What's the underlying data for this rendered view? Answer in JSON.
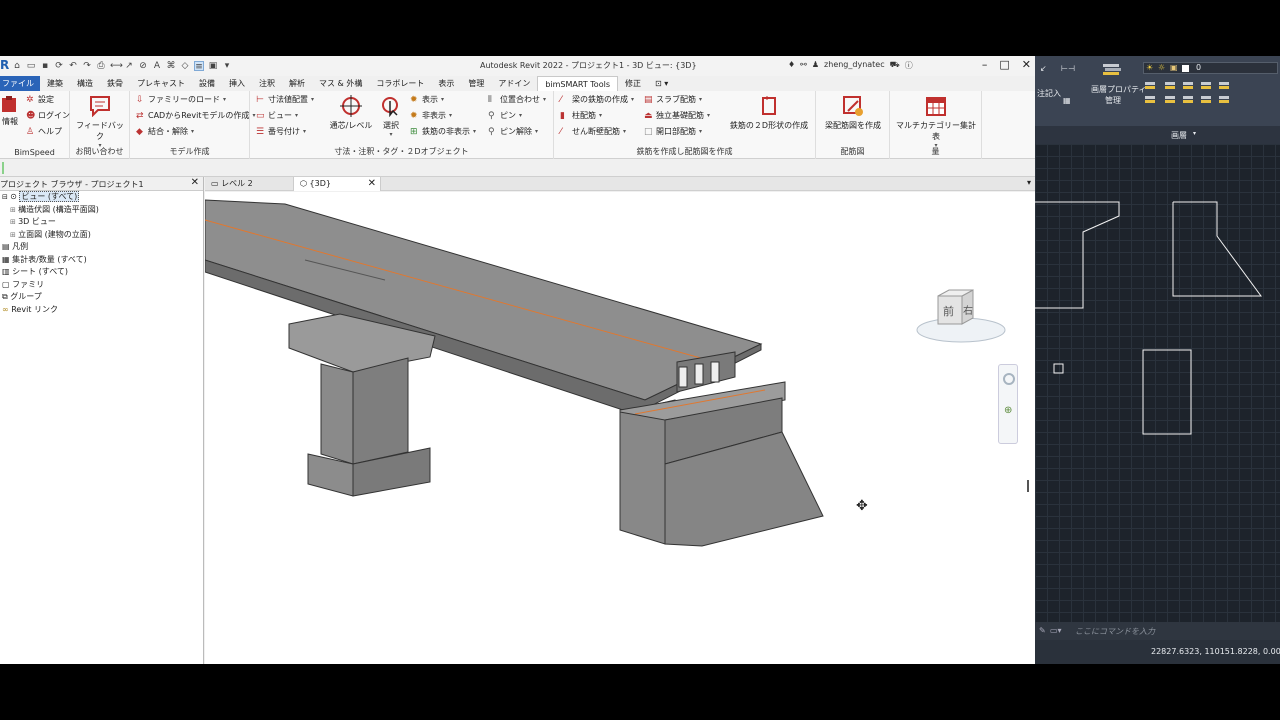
{
  "revit": {
    "window_title": "Autodesk Revit 2022 - プロジェクト1 - 3D ビュー: {3D}",
    "user": "zheng_dynatec",
    "menus": [
      "ファイル",
      "建築",
      "構造",
      "鉄骨",
      "プレキャスト",
      "設備",
      "挿入",
      "注釈",
      "解析",
      "マス & 外構",
      "コラボレート",
      "表示",
      "管理",
      "アドイン",
      "bimSMART Tools",
      "修正"
    ],
    "active_menu": "bimSMART Tools",
    "ribbon": {
      "bimspeed": {
        "info": "情報",
        "settings": "設定",
        "login": "ログイン",
        "help": "ヘルプ",
        "label": "BimSpeed"
      },
      "feedback": {
        "button": "フィードバック",
        "label": "お問い合わせ"
      },
      "model": {
        "family_load": "ファミリーのロード",
        "cad_to_revit": "CADからRevitモデルの作成",
        "join": "結合・解除",
        "label": "モデル作成"
      },
      "annot": {
        "dim": "寸法値配置",
        "view": "ビュー",
        "number": "番号付け",
        "pass": "通芯/レベル",
        "select": "選択",
        "show": "表示",
        "hide": "非表示",
        "hide_rebar": "鉄筋の非表示",
        "align": "位置合わせ",
        "pin": "ピン",
        "unpin": "ピン解除",
        "label": "寸法・注釈・タグ・２Dオブジェクト"
      },
      "rebar": {
        "beam": "梁の鉄筋の作成",
        "slab": "スラブ配筋",
        "column": "柱配筋",
        "footing": "独立基礎配筋",
        "shear_wall": "せん断壁配筋",
        "opening": "開口部配筋",
        "shape2d": "鉄筋の２D形状の作成",
        "label": "鉄筋を作成し配筋図を作成"
      },
      "drawing": {
        "beam_drawing": "梁配筋図を作成",
        "label": "配筋図"
      },
      "quantity": {
        "multi": "マルチカテゴリー集計表",
        "label": "量"
      }
    },
    "browser": {
      "title": "プロジェクト ブラウザ - プロジェクト1",
      "items": [
        {
          "label": "ビュー (すべて)",
          "indent": 0
        },
        {
          "label": "構造伏図 (構造平面図)",
          "indent": 1
        },
        {
          "label": "3D ビュー",
          "indent": 1
        },
        {
          "label": "立面図 (建物の立面)",
          "indent": 1
        },
        {
          "label": "凡例",
          "indent": 0
        },
        {
          "label": "集計表/数量 (すべて)",
          "indent": 0
        },
        {
          "label": "シート (すべて)",
          "indent": 0
        },
        {
          "label": "ファミリ",
          "indent": 0
        },
        {
          "label": "グループ",
          "indent": 0
        },
        {
          "label": "Revit リンク",
          "indent": 0
        }
      ]
    },
    "tabs": [
      {
        "label": "レベル 2",
        "active": false
      },
      {
        "label": "{3D}",
        "active": true
      }
    ],
    "viewcube": {
      "front": "前",
      "right": "右"
    }
  },
  "acad": {
    "ribbon": {
      "note": "注記入",
      "props": "画層プロパティ",
      "manage": "管理",
      "layer_value": "0",
      "layer_label": "画層"
    },
    "command_placeholder": "ここにコマンドを入力",
    "coordinates": "22827.6323, 110151.8228, 0.0000"
  },
  "colors": {
    "accent": "#2a64b8",
    "bridge": "#8a8a8a",
    "rebar_line": "#e07830",
    "acad_bg": "#1d232b"
  }
}
